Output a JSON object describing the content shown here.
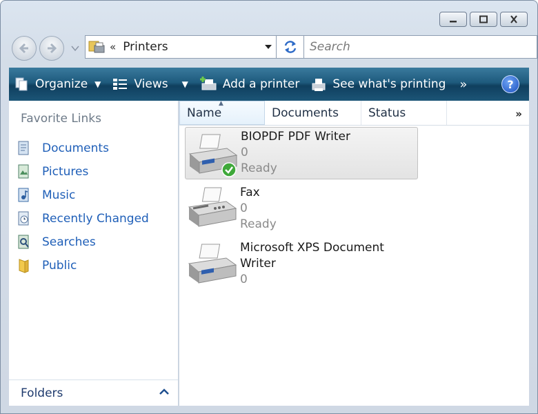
{
  "address": {
    "chevron": "«",
    "location": "Printers"
  },
  "search": {
    "placeholder": "Search"
  },
  "toolbar": {
    "organize": "Organize",
    "views": "Views",
    "add_printer": "Add a printer",
    "see_printing": "See what's printing",
    "more": "»",
    "help": "?"
  },
  "sidebar": {
    "title": "Favorite Links",
    "items": [
      {
        "label": "Documents",
        "icon": "documents-icon"
      },
      {
        "label": "Pictures",
        "icon": "pictures-icon"
      },
      {
        "label": "Music",
        "icon": "music-icon"
      },
      {
        "label": "Recently Changed",
        "icon": "recently-changed-icon"
      },
      {
        "label": "Searches",
        "icon": "searches-icon"
      },
      {
        "label": "Public",
        "icon": "public-folder-icon"
      }
    ],
    "folders_label": "Folders"
  },
  "columns": {
    "name": "Name",
    "documents": "Documents",
    "status": "Status",
    "more": "»"
  },
  "printers": [
    {
      "name": "BIOPDF PDF Writer",
      "documents": "0",
      "status": "Ready",
      "default": true,
      "selected": true
    },
    {
      "name": "Fax",
      "documents": "0",
      "status": "Ready",
      "default": false,
      "selected": false
    },
    {
      "name_line1": "Microsoft XPS Document",
      "name_line2": "Writer",
      "documents": "0",
      "default": false,
      "selected": false
    }
  ],
  "colors": {
    "toolbar": "#1e5a7d",
    "link": "#1f5fb8",
    "selection": "#e3e3e3"
  }
}
